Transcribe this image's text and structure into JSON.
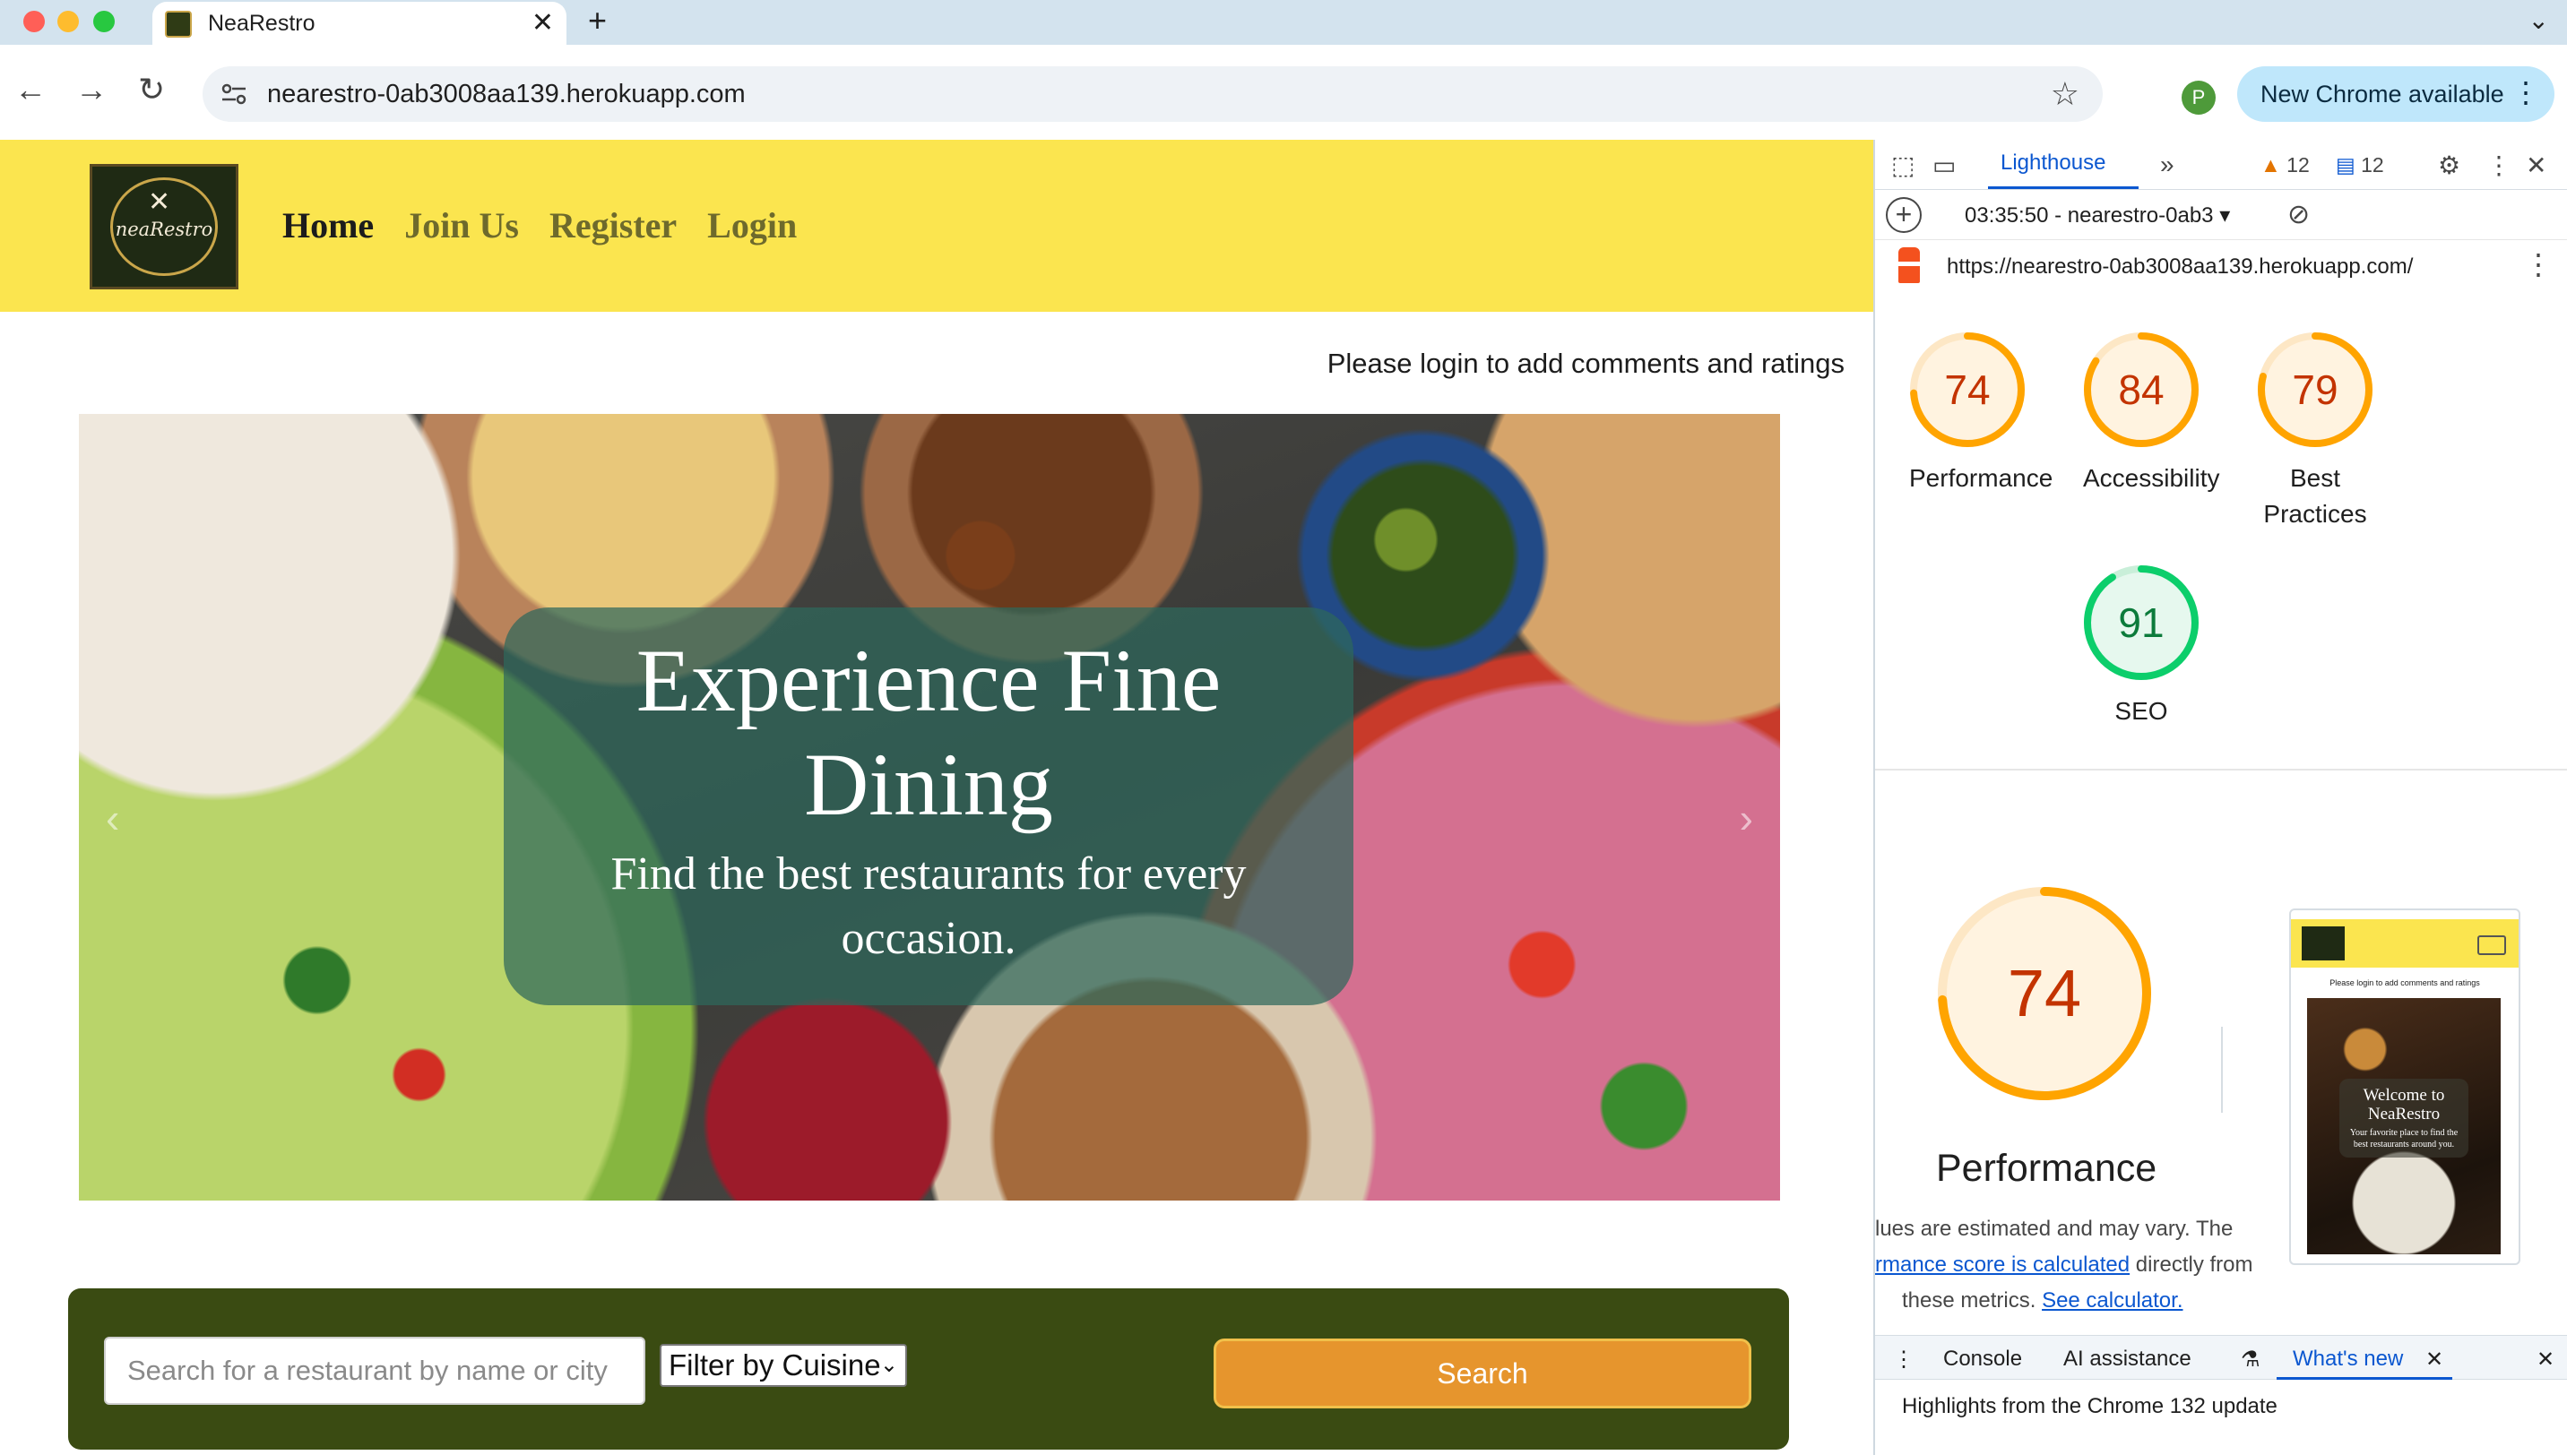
{
  "browser": {
    "tab_title": "NeaRestro",
    "tab_close": "✕",
    "new_tab": "+",
    "tab_menu": "⌄",
    "url": "nearestro-0ab3008aa139.herokuapp.com",
    "profile_initial": "P",
    "update_label": "New Chrome available",
    "update_menu": "⋮"
  },
  "site": {
    "logo_text": "neaRestro",
    "nav": [
      "Home",
      "Join Us",
      "Register",
      "Login"
    ],
    "login_note": "Please login to add comments and ratings",
    "hero": {
      "title": "Experience Fine Dining",
      "subtitle": "Find the best restaurants for every occasion.",
      "prev_arrow": "‹",
      "next_arrow": "›"
    },
    "search": {
      "placeholder": "Search for a restaurant by name or city",
      "filter_label": "Filter by Cuisine",
      "button_label": "Search"
    }
  },
  "devtools": {
    "active_panel": "Lighthouse",
    "more_panels": "»",
    "warnings_count": "12",
    "messages_count": "12",
    "run_label": "03:35:50 - nearestro-0ab3 ▾",
    "report_url": "https://nearestro-0ab3008aa139.herokuapp.com/",
    "scores": [
      {
        "label": "Performance",
        "value": 74,
        "color": "#ffa400"
      },
      {
        "label": "Accessibility",
        "value": 84,
        "color": "#ffa400"
      },
      {
        "label": "Best Practices",
        "value": 79,
        "color": "#ffa400"
      },
      {
        "label": "SEO",
        "value": 91,
        "color": "#0cce6b"
      }
    ],
    "performance_detail": {
      "score": 74,
      "label": "Performance",
      "note_line1": "lues are estimated and may vary. The",
      "note_link1": "rmance score is calculated",
      "note_line2_rest": " directly from",
      "note_line3": "these metrics.",
      "note_link2": "See calculator."
    },
    "thumbnail": {
      "note": "Please login to add comments and ratings",
      "title": "Welcome to NeaRestro",
      "subtitle": "Your favorite place to find the best restaurants around you."
    },
    "drawer": {
      "tabs": [
        "Console",
        "AI assistance",
        "What's new"
      ],
      "close": "✕",
      "content": "Highlights from the Chrome 132 update"
    }
  }
}
